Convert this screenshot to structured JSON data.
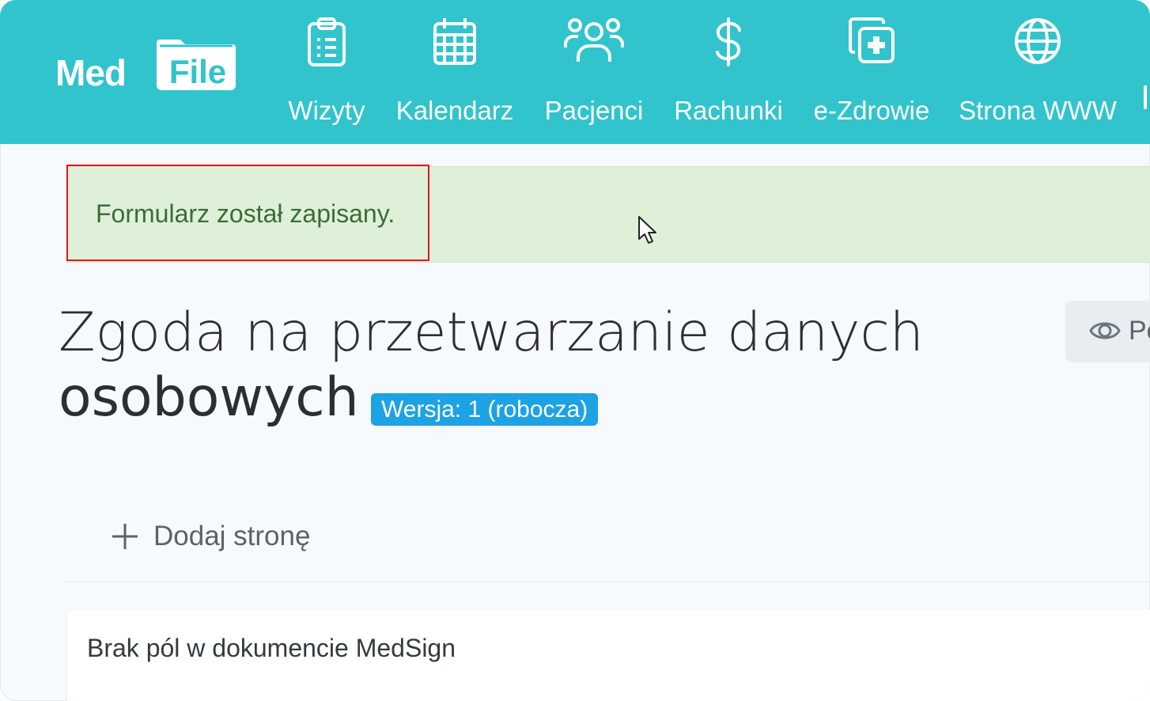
{
  "brand": {
    "logo_part1": "Med",
    "logo_part2": "File",
    "nav_color": "#31c4cc"
  },
  "nav": {
    "items": [
      {
        "label": "Wizyty",
        "icon": "clipboard-list-icon"
      },
      {
        "label": "Kalendarz",
        "icon": "calendar-icon"
      },
      {
        "label": "Pacjenci",
        "icon": "users-icon"
      },
      {
        "label": "Rachunki",
        "icon": "dollar-icon"
      },
      {
        "label": "e-Zdrowie",
        "icon": "medical-copy-icon"
      },
      {
        "label": "Strona WWW",
        "icon": "globe-icon"
      }
    ]
  },
  "alert": {
    "message": "Formularz został zapisany.",
    "color": "#dff0d8"
  },
  "page": {
    "title_line1": "Zgoda na przetwarzanie danych",
    "title_line2": "osobowych",
    "version_badge": "Wersja: 1 (robocza)",
    "badge_color": "#1da2e4",
    "preview_label": "Po"
  },
  "actions": {
    "add_page_label": "Dodaj stronę"
  },
  "card": {
    "empty_message": "Brak pól w dokumencie MedSign"
  }
}
